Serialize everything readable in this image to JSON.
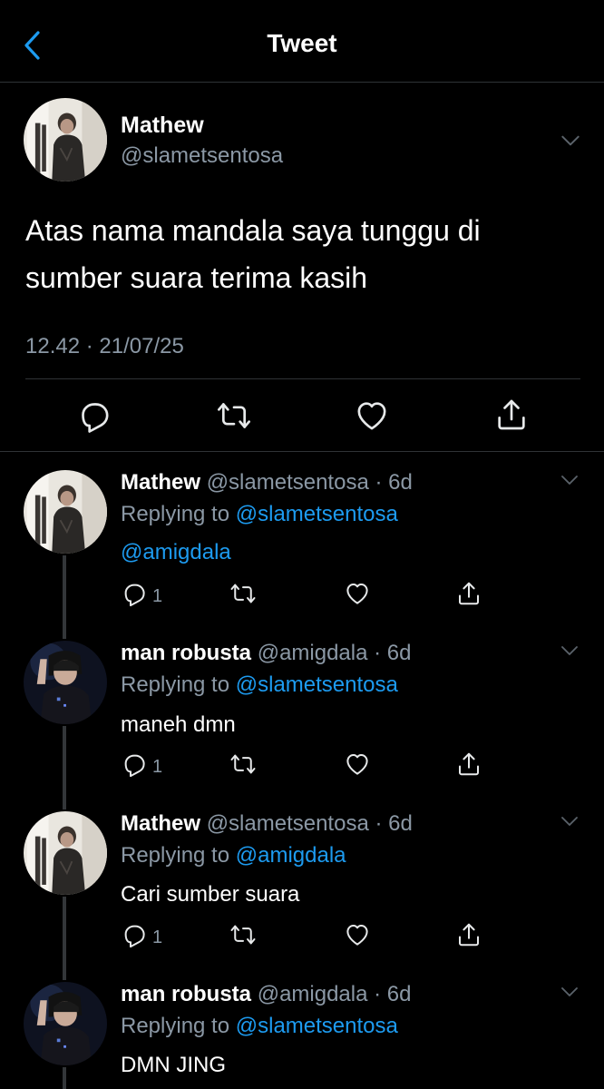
{
  "header": {
    "title": "Tweet",
    "back_icon": "chevron-left-icon",
    "accent": "#1d9bf0"
  },
  "main_tweet": {
    "name": "Mathew",
    "handle": "@slametsentosa",
    "text": "Atas nama mandala saya tunggu di sumber suara terima kasih",
    "meta": "12.42 · 21/07/25",
    "actions": [
      "reply-icon",
      "retweet-icon",
      "like-icon",
      "share-icon"
    ]
  },
  "replies": [
    {
      "name": "Mathew",
      "handle": "@slametsentosa",
      "time": "6d",
      "replying_label": "Replying to",
      "replying_to": "@slametsentosa",
      "text": "@amigdala",
      "reply_count": "1"
    },
    {
      "name": "man robusta",
      "handle": "@amigdala",
      "time": "6d",
      "replying_label": "Replying to",
      "replying_to": "@slametsentosa",
      "text": "maneh dmn",
      "reply_count": "1"
    },
    {
      "name": "Mathew",
      "handle": "@slametsentosa",
      "time": "6d",
      "replying_label": "Replying to",
      "replying_to": "@amigdala",
      "text": "Cari sumber suara",
      "reply_count": "1"
    },
    {
      "name": "man robusta",
      "handle": "@amigdala",
      "time": "6d",
      "replying_label": "Replying to",
      "replying_to": "@slametsentosa",
      "text": "DMN JING"
    }
  ],
  "colors": {
    "background": "#000000",
    "text": "#e7e9ea",
    "secondary": "#8b98a5",
    "link": "#1d9bf0",
    "divider": "#2f3336"
  }
}
